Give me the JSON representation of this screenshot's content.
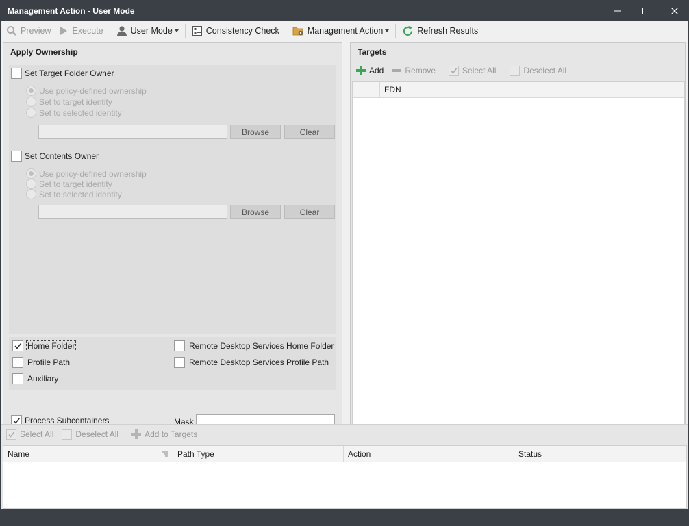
{
  "window": {
    "title": "Management Action - User Mode"
  },
  "toolbar": {
    "preview": "Preview",
    "execute": "Execute",
    "user_mode": "User Mode",
    "consistency_check": "Consistency Check",
    "management_action": "Management Action",
    "refresh_results": "Refresh Results"
  },
  "apply_ownership": {
    "title": "Apply Ownership",
    "target_folder_owner": {
      "label": "Set Target Folder Owner",
      "options": [
        "Use policy-defined ownership",
        "Set to target identity",
        "Set to selected identity"
      ],
      "browse": "Browse",
      "clear": "Clear"
    },
    "contents_owner": {
      "label": "Set Contents Owner",
      "options": [
        "Use policy-defined ownership",
        "Set to target identity",
        "Set to selected identity"
      ],
      "browse": "Browse",
      "clear": "Clear"
    },
    "path_types": {
      "home_folder": "Home Folder",
      "profile_path": "Profile Path",
      "auxiliary": "Auxiliary",
      "rds_home_folder": "Remote Desktop Services Home Folder",
      "rds_profile_path": "Remote Desktop Services Profile Path"
    },
    "process_subcontainers": "Process Subcontainers",
    "mask_label": "Mask"
  },
  "targets": {
    "title": "Targets",
    "add": "Add",
    "remove": "Remove",
    "select_all": "Select All",
    "deselect_all": "Deselect All",
    "columns": [
      "FDN"
    ]
  },
  "results": {
    "select_all": "Select All",
    "deselect_all": "Deselect All",
    "add_to_targets": "Add to Targets",
    "columns": [
      "Name",
      "Path Type",
      "Action",
      "Status"
    ]
  },
  "colors": {
    "accent_green": "#3aa65a",
    "titlebar": "#3b4046"
  }
}
